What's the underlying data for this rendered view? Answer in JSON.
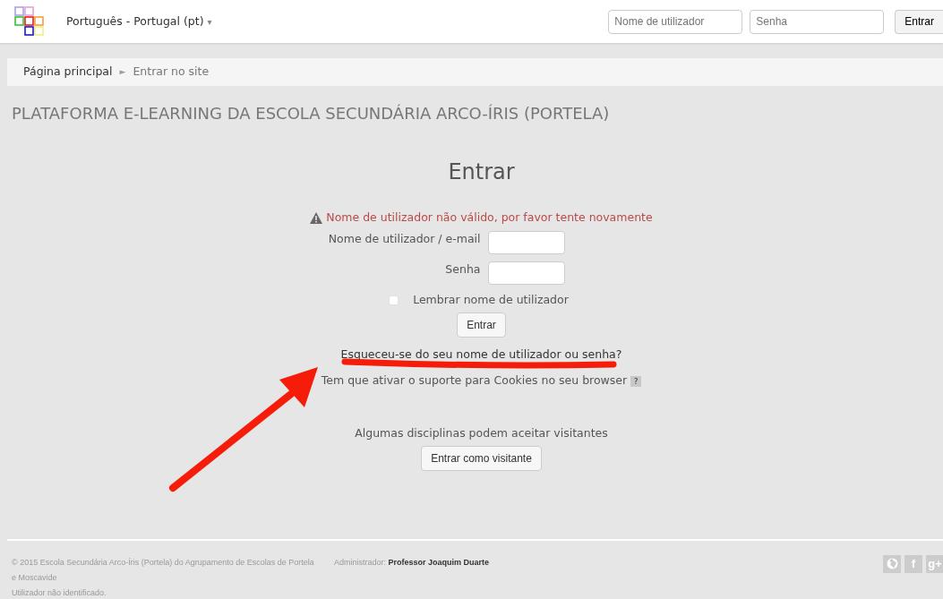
{
  "navbar": {
    "language": "Português - Portugal (pt)",
    "caret": "▾",
    "username": {
      "placeholder": "Nome de utilizador"
    },
    "password": {
      "placeholder": "Senha"
    },
    "login_button": "Entrar"
  },
  "breadcrumb": [
    {
      "label": "Página principal",
      "selected": false
    },
    {
      "label": "Entrar no site",
      "selected": true
    }
  ],
  "breadcrumb_separator": "►",
  "site_title": "PLATAFORMA E-LEARNING DA ESCOLA SECUNDÁRIA ARCO-ÍRIS (PORTELA)",
  "login": {
    "heading": "Entrar",
    "error": "Nome de utilizador não válido, por favor tente novamente",
    "fields": [
      {
        "label": "Nome de utilizador / e-mail"
      },
      {
        "label": "Senha"
      }
    ],
    "remember": {
      "label": "Lembrar nome de utilizador",
      "checked": false
    },
    "submit": "Entrar",
    "forgot_link": "Esqueceu-se do seu nome de utilizador ou senha?",
    "cookies_note": "Tem que ativar o suporte para Cookies no seu browser",
    "cookies_help": "?",
    "guest_note": "Algumas disciplinas podem aceitar visitantes",
    "guest_button": "Entrar como visitante"
  },
  "footer": {
    "copyright": "© 2015 Escola Secundária Arco-Íris (Portela) do Agrupamento de Escolas de Portela e Moscavide",
    "admin": "Administrador: **Professor Joaquim Duarte**",
    "login_info": "Utilizador não identificado.",
    "social": [
      {
        "kind": "globe"
      },
      {
        "kind": "text",
        "label": "f"
      },
      {
        "kind": "text",
        "label": "g+"
      }
    ]
  }
}
